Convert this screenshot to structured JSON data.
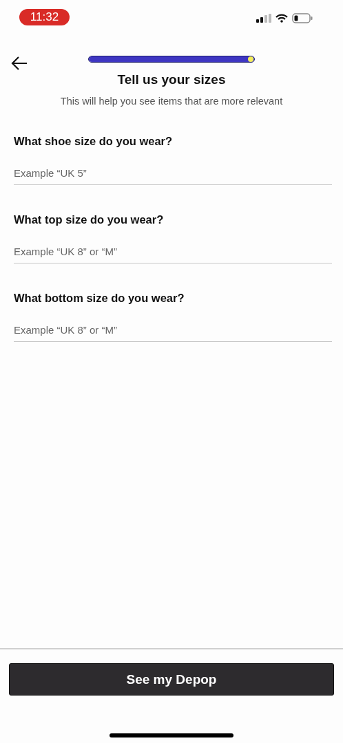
{
  "status_bar": {
    "time": "11:32"
  },
  "progress": {
    "level": 1
  },
  "header": {
    "title": "Tell us your sizes",
    "subtitle": "This will help you see items that are more relevant"
  },
  "questions": [
    {
      "label": "What shoe size do you wear?",
      "placeholder": "Example “UK 5”"
    },
    {
      "label": "What top size do you wear?",
      "placeholder": "Example “UK 8” or “M”"
    },
    {
      "label": "What bottom size do you wear?",
      "placeholder": "Example “UK 8” or “M”"
    }
  ],
  "primary_button": {
    "label": "See my Depop"
  }
}
